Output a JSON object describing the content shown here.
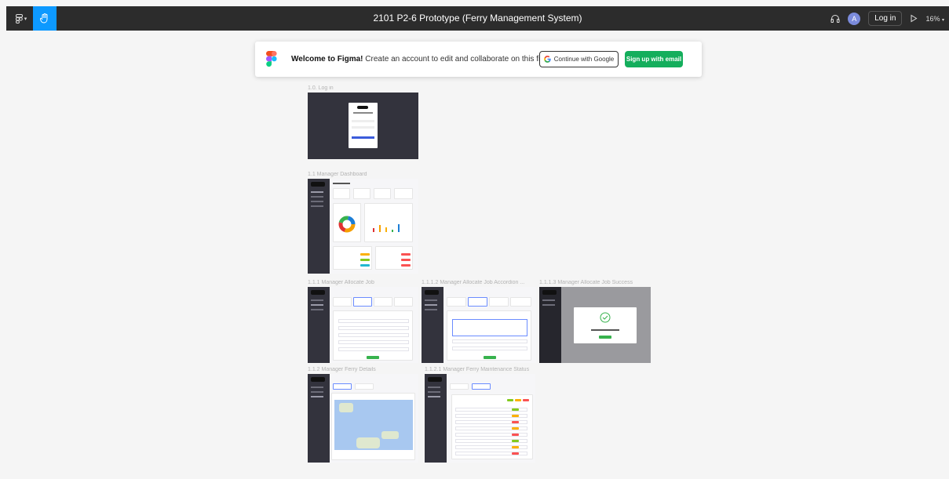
{
  "toolbar": {
    "title": "2101 P2-6 Prototype (Ferry Management System)",
    "avatar_initial": "A",
    "login_label": "Log in",
    "zoom": "16%"
  },
  "banner": {
    "welcome": "Welcome to Figma!",
    "message": "Create an account to edit and collaborate on this file.",
    "google_label": "Continue with Google",
    "email_label": "Sign up with email"
  },
  "frames": {
    "login": {
      "label": "1.0. Log in"
    },
    "dashboard": {
      "label": "1.1 Manager Dashboard"
    },
    "allocate": {
      "label": "1.1.1 Manager Allocate Job"
    },
    "accordion": {
      "label": "1.1.1.2 Manager Allocate Job Accordion ..."
    },
    "success": {
      "label": "1.1.1.3 Manager Allocate Job Success"
    },
    "ferry_details": {
      "label": "1.1.2 Manager Ferry Details"
    },
    "maintenance": {
      "label": "1.1.2.1 Manager Ferry Maintenance Status"
    }
  },
  "colors": {
    "toolbar": "#2c2c2c",
    "accent": "#0d99ff",
    "signup": "#14ae5c",
    "canvas": "#f5f5f5",
    "sidebar": "#33333d"
  }
}
